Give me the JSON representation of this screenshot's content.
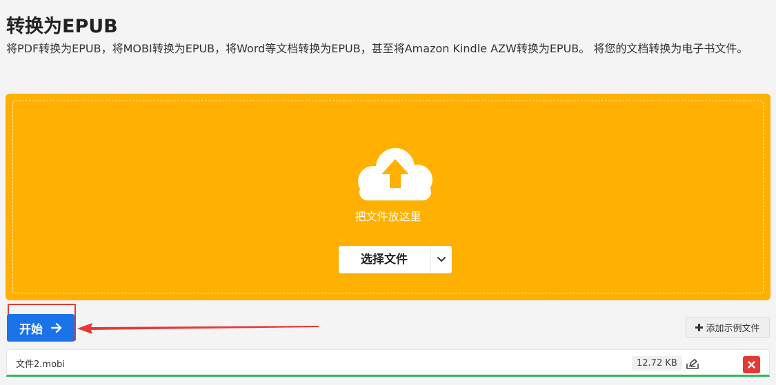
{
  "header": {
    "title": "转换为EPUB",
    "description": "将PDF转换为EPUB，将MOBI转换为EPUB，将Word等文档转换为EPUB，甚至将Amazon Kindle AZW转换为EPUB。 将您的文档转换为电子书文件。"
  },
  "dropzone": {
    "drop_text": "把文件放这里",
    "choose_label": "选择文件",
    "icons": {
      "cloud": "cloud-upload-icon",
      "split": "chevron-down-icon"
    }
  },
  "actions": {
    "start_label": "开始",
    "add_sample_label": "添加示例文件",
    "icons": {
      "start": "arrow-right-icon",
      "add": "plus-icon"
    }
  },
  "files": [
    {
      "name": "文件2.mobi",
      "size": "12.72 KB",
      "status_color": "#2eb85c"
    }
  ],
  "colors": {
    "dropzone": "#ffb000",
    "primary": "#1a73e8",
    "annotation": "#e53935",
    "danger": "#e53935",
    "success": "#2eb85c"
  }
}
